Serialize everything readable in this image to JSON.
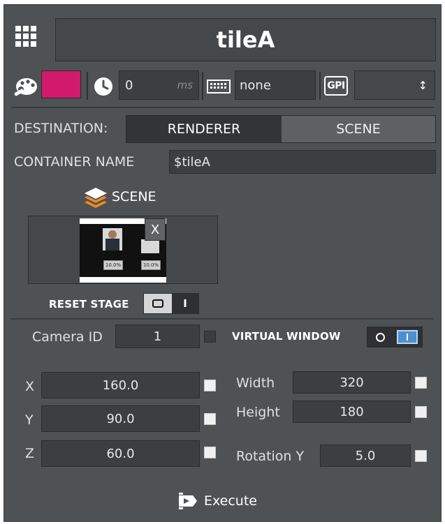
{
  "header": {
    "title": "tileA"
  },
  "toolbar": {
    "color": "#d11a6b",
    "delay_value": "0",
    "delay_unit": "ms",
    "keyboard_value": "none",
    "gpi_label": "GPI",
    "gpi_select_value": "",
    "gpi_arrow": "↕"
  },
  "destination": {
    "label": "DESTINATION:",
    "options": [
      "RENDERER",
      "SCENE"
    ],
    "selected": "RENDERER"
  },
  "container": {
    "label": "CONTAINER NAME",
    "value": "$tileA"
  },
  "scene": {
    "label": "SCENE",
    "remove_label": "X",
    "thumb_badge_1": "10.0%",
    "thumb_badge_2": "10.0%"
  },
  "reset_stage": {
    "label": "RESET STAGE",
    "toggle_on": "O",
    "toggle_off": "I"
  },
  "camera": {
    "label": "Camera ID",
    "value": "1"
  },
  "virtual_window": {
    "label": "VIRTUAL WINDOW",
    "toggle_on": "O",
    "toggle_off": "I",
    "enabled": true
  },
  "position": {
    "x": {
      "label": "X",
      "value": "160.0"
    },
    "y": {
      "label": "Y",
      "value": "90.0"
    },
    "z": {
      "label": "Z",
      "value": "60.0"
    }
  },
  "size": {
    "width": {
      "label": "Width",
      "value": "320"
    },
    "height": {
      "label": "Height",
      "value": "180"
    },
    "rotation_y": {
      "label": "Rotation Y",
      "value": "5.0"
    }
  },
  "execute": {
    "label": "Execute"
  }
}
